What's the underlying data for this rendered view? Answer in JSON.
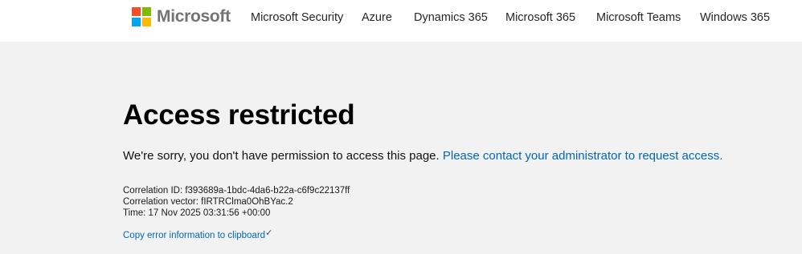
{
  "header": {
    "logo_text": "Microsoft",
    "logo_colors": [
      "#f25022",
      "#7fba00",
      "#00a4ef",
      "#ffb900"
    ],
    "nav": [
      {
        "label": "Microsoft Security"
      },
      {
        "label": "Azure"
      },
      {
        "label": "Dynamics 365"
      },
      {
        "label": "Microsoft 365"
      },
      {
        "label": "Microsoft Teams"
      },
      {
        "label": "Windows 365"
      }
    ]
  },
  "main": {
    "title": "Access restricted",
    "message": "We're sorry, you don't have permission to access this page.",
    "message_link": "Please contact your administrator to request access.",
    "correlation_id": "Correlation ID: f393689a-1bdc-4da6-b22a-c6f9c22137ff",
    "correlation_vector": "Correlation vector: fIRTRClma0OhBYac.2",
    "time": "Time: 17 Nov 2025 03:31:56 +00:00",
    "copy_label": "Copy error information to clipboard",
    "copy_icon": "checkmark-icon",
    "link_color": "#0067b8",
    "background_color": "#f2f2f2"
  }
}
